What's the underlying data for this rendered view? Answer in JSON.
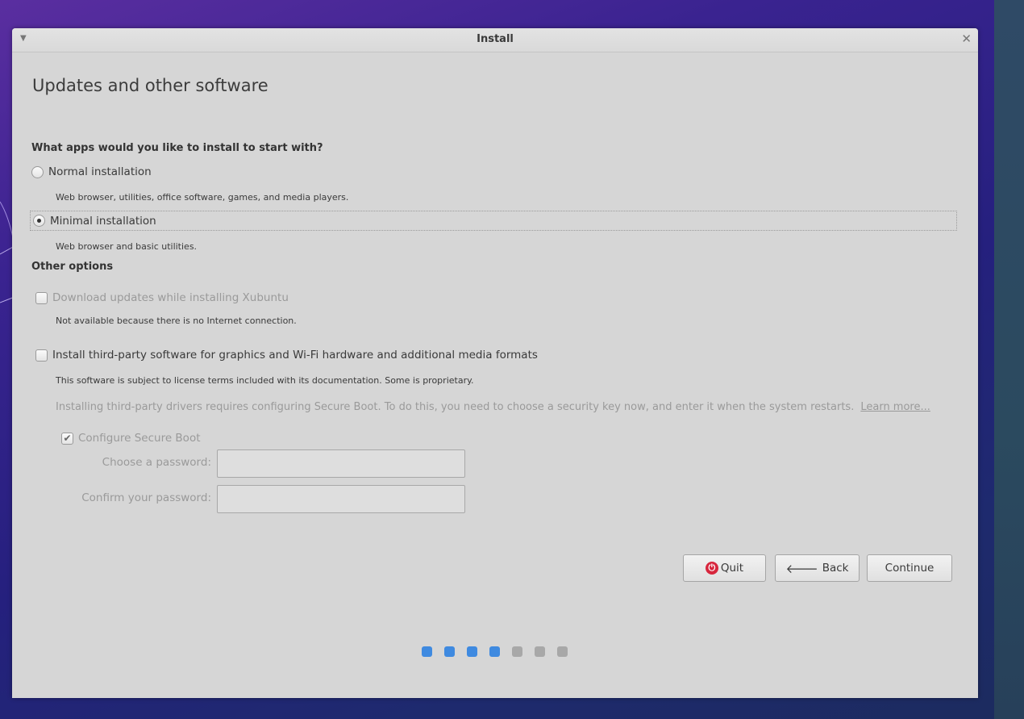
{
  "window": {
    "title": "Install",
    "menu_icon": "dropdown-arrow-icon",
    "close_icon": "close-icon"
  },
  "page": {
    "title": "Updates and other software"
  },
  "apps_section": {
    "heading": "What apps would you like to install to start with?",
    "normal": {
      "label": "Normal installation",
      "desc": "Web browser, utilities, office software, games, and media players.",
      "selected": false
    },
    "minimal": {
      "label": "Minimal installation",
      "desc": "Web browser and basic utilities.",
      "selected": true
    }
  },
  "other_section": {
    "heading": "Other options",
    "download_updates": {
      "label": "Download updates while installing Xubuntu",
      "note": "Not available because there is no Internet connection.",
      "checked": false,
      "enabled": false
    },
    "third_party": {
      "label": "Install third-party software for graphics and Wi-Fi hardware and additional media formats",
      "note": "This software is subject to license terms included with its documentation. Some is proprietary.",
      "checked": false,
      "enabled": true
    },
    "secure_boot_info": "Installing third-party drivers requires configuring Secure Boot. To do this, you need to choose a security key now, and enter it when the system restarts.",
    "learn_more": "Learn more...",
    "secure_boot": {
      "label": "Configure Secure Boot",
      "checked": true,
      "enabled": false
    },
    "password_label": "Choose a password:",
    "confirm_label": "Confirm your password:",
    "password_value": "",
    "confirm_value": ""
  },
  "buttons": {
    "quit": "Quit",
    "back": "Back",
    "continue": "Continue"
  },
  "progress": {
    "total_steps": 7,
    "completed_steps": 4
  },
  "colors": {
    "accent": "#3f8ae0",
    "quit": "#d7263d",
    "window_bg": "#d6d6d6"
  }
}
